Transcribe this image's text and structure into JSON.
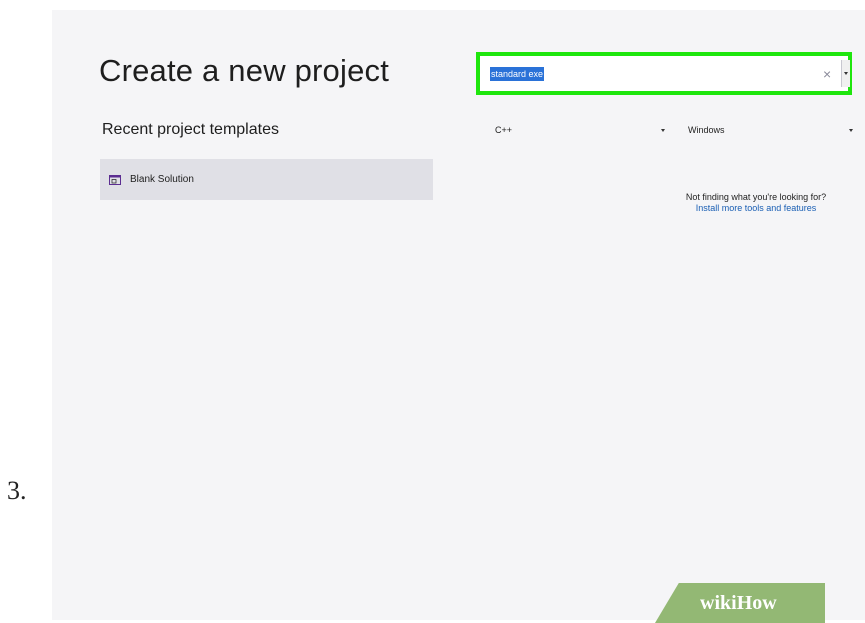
{
  "step": {
    "number": "3."
  },
  "dialog": {
    "title": "Create a new project",
    "recent_heading": "Recent project templates",
    "recent_items": [
      {
        "label": "Blank Solution",
        "icon": "solution-icon"
      }
    ]
  },
  "search": {
    "value": "standard exe",
    "placeholder": "",
    "clear_icon": "×",
    "highlight_color": "#1ee60d",
    "selection_color": "#2a72d8"
  },
  "filters": {
    "language": "C++",
    "platform": "Windows"
  },
  "help": {
    "text": "Not finding what you're looking for?",
    "link": "Install more tools and features"
  },
  "watermark": {
    "part1": "wiki",
    "part2": "How"
  }
}
